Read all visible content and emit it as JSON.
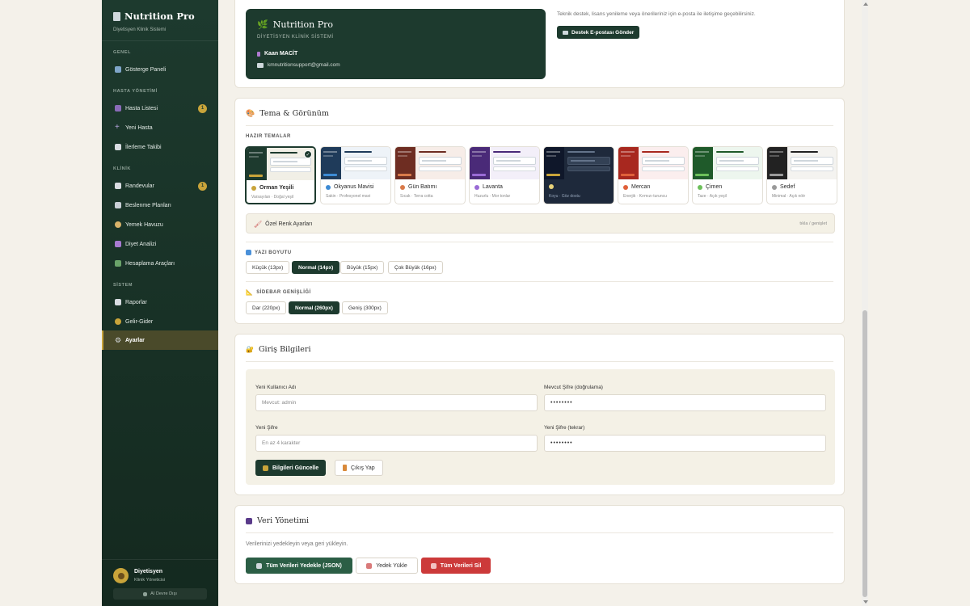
{
  "sidebar": {
    "brand_title": "Nutrition Pro",
    "brand_subtitle": "Diyetisyen Klinik Sistemi",
    "sections": {
      "general": "GENEL",
      "patients": "HASTA YÖNETİMİ",
      "clinic": "KLİNİK",
      "system": "SİSTEM"
    },
    "items": {
      "dashboard": "Gösterge Paneli",
      "patient_list": "Hasta Listesi",
      "new_patient": "Yeni Hasta",
      "progress": "İlerleme Takibi",
      "appointments": "Randevular",
      "nutrition_plans": "Beslenme Planları",
      "food_pool": "Yemek Havuzu",
      "diet_analysis": "Diyet Analizi",
      "calculators": "Hesaplama Araçları",
      "reports": "Raporlar",
      "income_expense": "Gelir-Gider",
      "settings": "Ayarlar"
    },
    "badges": {
      "patient_list": "1",
      "appointments": "1"
    },
    "user_name": "Diyetisyen",
    "user_role": "Klinik Yöneticisi",
    "ai_status": "AI Devre Dışı"
  },
  "about": {
    "title": "Nutrition Pro",
    "subtitle": "DİYETİSYEN KLİNİK SİSTEMİ",
    "author": "Kaan MACİT",
    "email": "kmnutritionsupport@gmail.com",
    "support_text": "Teknik destek, lisans yenileme veya önerileriniz için e-posta ile iletişime geçebilirsiniz.",
    "support_button": "Destek E-postası Gönder"
  },
  "theme_section": {
    "title": "Tema & Görünüm",
    "presets_label": "HAZIR TEMALAR",
    "themes": [
      {
        "name": "Orman Yeşili",
        "desc": "Varsayılan · Doğal yeşil",
        "side": "#1d3a2e",
        "main": "#f1efe6",
        "accent": "#c9a43a",
        "bar": "#1d3a2e",
        "selected": true
      },
      {
        "name": "Okyanus Mavisi",
        "desc": "Sakin · Profesyonel mavi",
        "side": "#1f3b5a",
        "main": "#eef3f8",
        "accent": "#3d8bd4",
        "bar": "#1f3b5a",
        "selected": false
      },
      {
        "name": "Gün Batımı",
        "desc": "Sıcak · Terra cotta",
        "side": "#6e2d22",
        "main": "#f7ede8",
        "accent": "#d97a4a",
        "bar": "#6e2d22",
        "selected": false
      },
      {
        "name": "Lavanta",
        "desc": "Huzurlu · Mor tonlar",
        "side": "#4a2a78",
        "main": "#f3eff9",
        "accent": "#9a6bd6",
        "bar": "#4a2a78",
        "selected": false
      },
      {
        "name": "",
        "desc": "Koyu · Göz dostu",
        "side": "#0f172a",
        "main": "#1e293b",
        "accent": "#c9a43a",
        "bar": "#94a3b8",
        "selected": false,
        "dark": true
      },
      {
        "name": "Mercan",
        "desc": "Enerjik · Kırmızı-turuncu",
        "side": "#a8281f",
        "main": "#fbeeee",
        "accent": "#e0603a",
        "bar": "#a8281f",
        "selected": false
      },
      {
        "name": "Çimen",
        "desc": "Taze · Açık yeşil",
        "side": "#1f5a2a",
        "main": "#edf6ee",
        "accent": "#6cbf5a",
        "bar": "#1f5a2a",
        "selected": false
      },
      {
        "name": "Sedef",
        "desc": "Minimal · Açık nötr",
        "side": "#222222",
        "main": "#f4f3f0",
        "accent": "#9a9a9a",
        "bar": "#222222",
        "selected": false
      }
    ],
    "custom_label": "Özel Renk Ayarları",
    "custom_hint": "tıkla / genişlet",
    "font_label": "YAZI BOYUTU",
    "font_options": [
      "Küçük (13px)",
      "Normal (14px)",
      "Büyük (15px)",
      "Çok Büyük (16px)"
    ],
    "font_selected": "Normal (14px)",
    "sidebar_label": "SİDEBAR GENİŞLİĞİ",
    "sidebar_options": [
      "Dar (220px)",
      "Normal (260px)",
      "Geniş (300px)"
    ],
    "sidebar_selected": "Normal (260px)"
  },
  "login": {
    "title": "Giriş Bilgileri",
    "username_label": "Yeni Kullanıcı Adı",
    "username_placeholder": "Mevcut: admin",
    "current_pw_label": "Mevcut Şifre (doğrulama)",
    "current_pw_value": "••••••••",
    "new_pw_label": "Yeni Şifre",
    "new_pw_placeholder": "En az 4 karakter",
    "new_pw2_label": "Yeni Şifre (tekrar)",
    "new_pw2_value": "••••••••",
    "update_button": "Bilgileri Güncelle",
    "logout_button": "Çıkış Yap"
  },
  "data_mgmt": {
    "title": "Veri Yönetimi",
    "desc": "Verilerinizi yedekleyin veya geri yükleyin.",
    "backup_button": "Tüm Verileri Yedekle (JSON)",
    "restore_button": "Yedek Yükle",
    "delete_button": "Tüm Verileri Sil"
  }
}
